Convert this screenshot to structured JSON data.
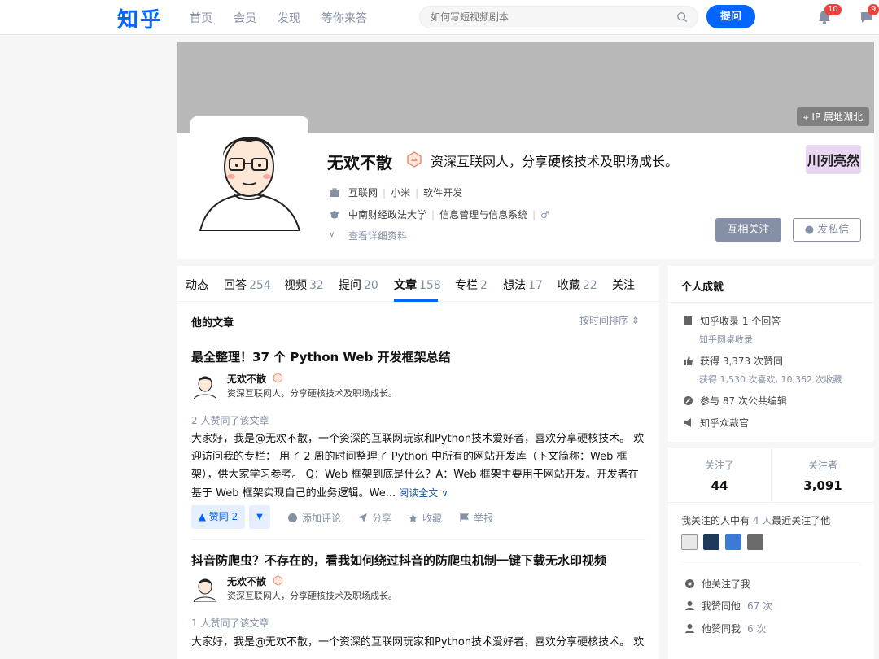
{
  "header": {
    "logo": "知乎",
    "nav": [
      "首页",
      "会员",
      "发现",
      "等你来答"
    ],
    "search_placeholder": "如何写短视频剧本",
    "ask_label": "提问",
    "notif_count": "10",
    "msg_count": "9"
  },
  "profile": {
    "ip_label": "IP 属地湖北",
    "name": "无欢不散",
    "headline": "资深互联网人，分享硬核技术及职场成长。",
    "work": [
      "互联网",
      "小米",
      "软件开发"
    ],
    "edu": [
      "中南财经政法大学",
      "信息管理与信息系统"
    ],
    "details_label": "查看详细资料",
    "stamp_text": "川列亮然",
    "follow_label": "互相关注",
    "dm_label": "发私信"
  },
  "tabs": [
    {
      "label": "动态",
      "count": ""
    },
    {
      "label": "回答",
      "count": "254"
    },
    {
      "label": "视频",
      "count": "32"
    },
    {
      "label": "提问",
      "count": "20"
    },
    {
      "label": "文章",
      "count": "158"
    },
    {
      "label": "专栏",
      "count": "2"
    },
    {
      "label": "想法",
      "count": "17"
    },
    {
      "label": "收藏",
      "count": "22"
    },
    {
      "label": "关注",
      "count": ""
    }
  ],
  "section": {
    "title": "他的文章",
    "sort_label": "按时间排序"
  },
  "articles": [
    {
      "title": "最全整理！37 个 Python Web 开发框架总结",
      "author": "无欢不散",
      "author_desc": "资深互联网人，分享硬核技术及职场成长。",
      "votes_text": "2 人赞同了该文章",
      "body": "大家好，我是@无欢不散，一个资深的互联网玩家和Python技术爱好者，喜欢分享硬核技术。 欢迎访问我的专栏： 用了 2 周的时间整理了 Python 中所有的网站开发库（下文简称：Web 框架），供大家学习参考。 Q：Web 框架到底是什么？A：Web 框架主要用于网站开发。开发者在基于 Web 框架实现自己的业务逻辑。We...",
      "read_more": "阅读全文",
      "vote_label": "▲ 赞同 2",
      "comment_label": "添加评论",
      "share_label": "分享",
      "collect_label": "收藏",
      "report_label": "举报"
    },
    {
      "title": "抖音防爬虫？不存在的，看我如何绕过抖音的防爬虫机制一键下载无水印视频",
      "author": "无欢不散",
      "author_desc": "资深互联网人，分享硬核技术及职场成长。",
      "votes_text": "1 人赞同了该文章",
      "body": "大家好，我是@无欢不散，一个资深的互联网玩家和Python技术爱好者，喜欢分享硬核技术。 欢"
    }
  ],
  "achievements": {
    "title": "个人成就",
    "items": [
      {
        "text": "知乎收录 1 个回答",
        "sub": "知乎圆桌收录"
      },
      {
        "text": "获得 3,373 次赞同",
        "sub": "获得 1,530 次喜欢, 10,362 次收藏"
      },
      {
        "text": "参与 87 次公共编辑",
        "sub": ""
      },
      {
        "text": "知乎众裁官",
        "sub": ""
      }
    ]
  },
  "follow": {
    "following_label": "关注了",
    "following": "44",
    "followers_label": "关注者",
    "followers": "3,091",
    "mutual_pre": "我关注的人中有",
    "mutual_count": "4 人",
    "mutual_post": "最近关注了他",
    "rel": [
      {
        "text": "他关注了我",
        "hl": ""
      },
      {
        "text": "我赞同他",
        "hl": "67 次"
      },
      {
        "text": "他赞同我",
        "hl": "6 次"
      }
    ]
  }
}
